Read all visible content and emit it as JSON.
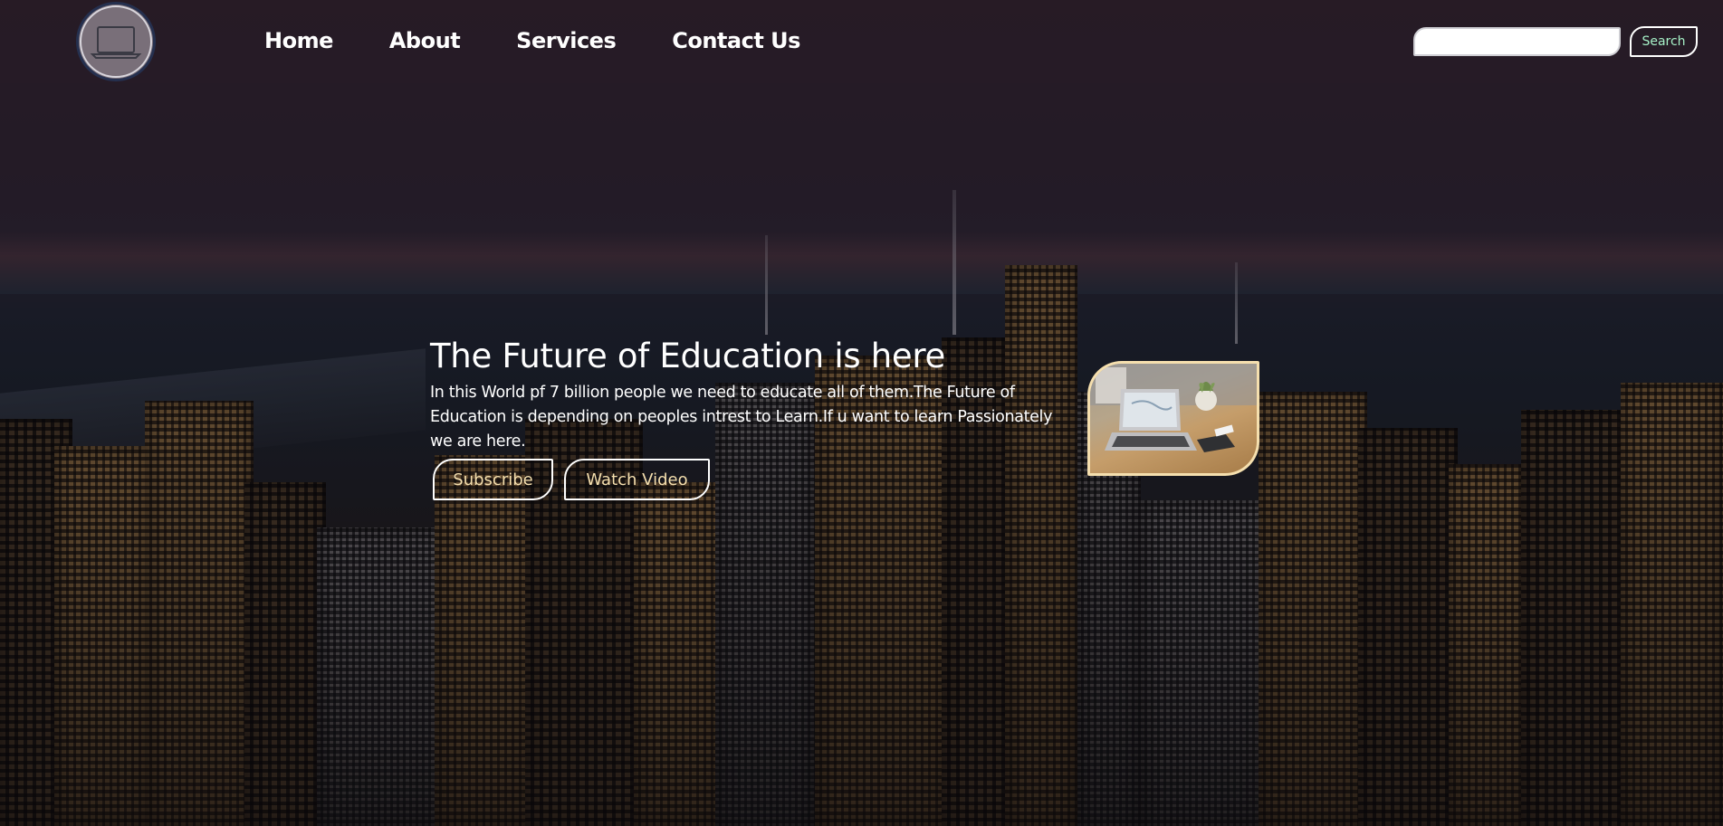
{
  "header": {
    "logo_icon": "laptop-icon",
    "nav": [
      {
        "label": "Home"
      },
      {
        "label": "About"
      },
      {
        "label": "Services"
      },
      {
        "label": "Contact Us"
      }
    ],
    "search": {
      "placeholder": "",
      "value": "",
      "button_label": "Search"
    }
  },
  "hero": {
    "title": "The Future of Education is here",
    "text": "In this World pf 7 billion people we need to educate all of them.The Future of Education is depending on peoples intrest to Learn.If u want to learn Passionately we are here.",
    "buttons": {
      "subscribe": "Subscribe",
      "watch_video": "Watch Video"
    },
    "image_icon": "laptop-on-desk-image"
  },
  "colors": {
    "button_text": "#f5dfae",
    "search_button_text": "#a6f2c8",
    "nav_text": "#ffffff",
    "logo_ring": "#25304f"
  }
}
